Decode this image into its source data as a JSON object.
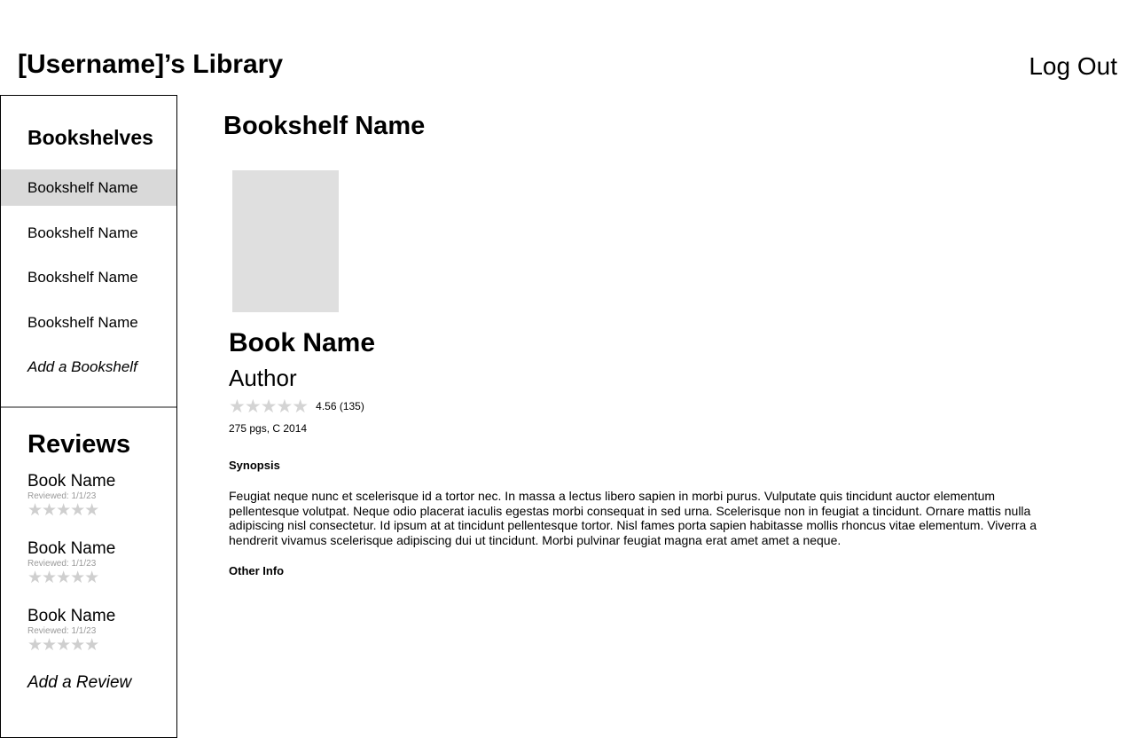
{
  "header": {
    "title": "[Username]’s Library",
    "logout_label": "Log Out"
  },
  "sidebar": {
    "shelves_heading": "Bookshelves",
    "shelves": [
      {
        "label": "Bookshelf Name",
        "selected": true
      },
      {
        "label": "Bookshelf Name",
        "selected": false
      },
      {
        "label": "Bookshelf Name",
        "selected": false
      },
      {
        "label": "Bookshelf Name",
        "selected": false
      }
    ],
    "add_shelf_label": "Add a Bookshelf",
    "reviews_heading": "Reviews",
    "reviews": [
      {
        "book": "Book Name",
        "date": "Reviewed: 1/1/23",
        "stars": "★★★★★"
      },
      {
        "book": "Book Name",
        "date": "Reviewed: 1/1/23",
        "stars": "★★★★★"
      },
      {
        "book": "Book Name",
        "date": "Reviewed: 1/1/23",
        "stars": "★★★★★"
      }
    ],
    "add_review_label": "Add a Review"
  },
  "main": {
    "shelf_title": "Bookshelf Name",
    "book": {
      "name": "Book Name",
      "author": "Author",
      "stars": "★★★★★",
      "rating_text": "4.56 (135)",
      "meta": "275 pgs, C 2014",
      "synopsis_heading": "Synopsis",
      "synopsis": "Feugiat neque nunc et scelerisque id a tortor nec. In massa a lectus libero sapien in morbi purus. Vulputate quis tincidunt auctor elementum pellentesque volutpat. Neque odio placerat iaculis egestas morbi consequat in sed urna. Scelerisque non in feugiat a tincidunt. Ornare mattis nulla adipiscing nisl consectetur. Id ipsum at at tincidunt pellentesque tortor. Nisl fames porta sapien habitasse mollis rhoncus vitae elementum. Viverra a hendrerit vivamus scelerisque adipiscing dui ut tincidunt. Morbi pulvinar feugiat magna erat amet amet a neque.",
      "other_info_heading": "Other Info"
    }
  },
  "colors": {
    "selected_shelf_bg": "#d9d9d9",
    "cover_placeholder": "#dfdfdf",
    "empty_star": "#cfcfcf"
  }
}
